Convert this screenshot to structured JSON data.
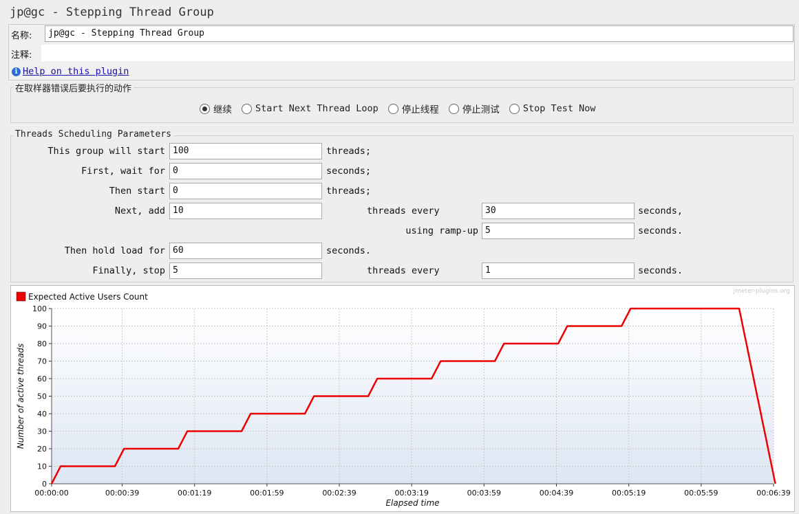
{
  "panel": {
    "title": "jp@gc - Stepping Thread Group"
  },
  "name_row": {
    "label": "名称:",
    "value": "jp@gc - Stepping Thread Group"
  },
  "comment_row": {
    "label": "注释:",
    "value": ""
  },
  "help": {
    "icon": "info-icon",
    "link": "Help on this plugin"
  },
  "on_error": {
    "legend": "在取样器错误后要执行的动作",
    "options": [
      {
        "label": "继续",
        "checked": true,
        "cjk": true
      },
      {
        "label": "Start Next Thread Loop",
        "checked": false,
        "cjk": false
      },
      {
        "label": "停止线程",
        "checked": false,
        "cjk": true
      },
      {
        "label": "停止测试",
        "checked": false,
        "cjk": true
      },
      {
        "label": "Stop Test Now",
        "checked": false,
        "cjk": false
      }
    ]
  },
  "params": {
    "legend": "Threads Scheduling Parameters",
    "rows": {
      "start": {
        "label": "This group will start",
        "value": "100",
        "unit": "threads;"
      },
      "wait": {
        "label": "First, wait for",
        "value": "0",
        "unit": "seconds;"
      },
      "then_start": {
        "label": "Then start",
        "value": "0",
        "unit": "threads;"
      },
      "next_add": {
        "label": "Next, add",
        "value": "10",
        "mid": "threads every",
        "value2": "30",
        "unit": "seconds,"
      },
      "ramp": {
        "label": "using ramp-up",
        "value": "5",
        "unit": "seconds."
      },
      "hold": {
        "label": "Then hold load for",
        "value": "60",
        "unit": "seconds."
      },
      "stop": {
        "label": "Finally, stop",
        "value": "5",
        "mid": "threads every",
        "value2": "1",
        "unit": "seconds."
      }
    }
  },
  "chart_data": {
    "type": "line",
    "watermark": "jmeter-plugins.org",
    "xlabel": "Elapsed time",
    "ylabel": "Number of active threads",
    "ylim": [
      0,
      100
    ],
    "xlim": [
      0,
      399
    ],
    "grid": true,
    "legend_position": "top-left",
    "y_ticks": [
      0,
      10,
      20,
      30,
      40,
      50,
      60,
      70,
      80,
      90,
      100
    ],
    "x_ticks": [
      {
        "t": 0,
        "label": "00:00:00"
      },
      {
        "t": 39,
        "label": "00:00:39"
      },
      {
        "t": 79,
        "label": "00:01:19"
      },
      {
        "t": 119,
        "label": "00:01:59"
      },
      {
        "t": 159,
        "label": "00:02:39"
      },
      {
        "t": 199,
        "label": "00:03:19"
      },
      {
        "t": 239,
        "label": "00:03:59"
      },
      {
        "t": 279,
        "label": "00:04:39"
      },
      {
        "t": 319,
        "label": "00:05:19"
      },
      {
        "t": 359,
        "label": "00:05:59"
      },
      {
        "t": 399,
        "label": "00:06:39"
      }
    ],
    "series": [
      {
        "name": "Expected Active Users Count",
        "color": "#ee0000",
        "points": [
          [
            0,
            0
          ],
          [
            5,
            10
          ],
          [
            35,
            10
          ],
          [
            40,
            20
          ],
          [
            70,
            20
          ],
          [
            75,
            30
          ],
          [
            105,
            30
          ],
          [
            110,
            40
          ],
          [
            140,
            40
          ],
          [
            145,
            50
          ],
          [
            175,
            50
          ],
          [
            180,
            60
          ],
          [
            210,
            60
          ],
          [
            215,
            70
          ],
          [
            245,
            70
          ],
          [
            250,
            80
          ],
          [
            280,
            80
          ],
          [
            285,
            90
          ],
          [
            315,
            90
          ],
          [
            320,
            100
          ],
          [
            380,
            100
          ],
          [
            381,
            95
          ],
          [
            382,
            90
          ],
          [
            383,
            85
          ],
          [
            384,
            80
          ],
          [
            385,
            75
          ],
          [
            386,
            70
          ],
          [
            387,
            65
          ],
          [
            388,
            60
          ],
          [
            389,
            55
          ],
          [
            390,
            50
          ],
          [
            391,
            45
          ],
          [
            392,
            40
          ],
          [
            393,
            35
          ],
          [
            394,
            30
          ],
          [
            395,
            25
          ],
          [
            396,
            20
          ],
          [
            397,
            15
          ],
          [
            398,
            10
          ],
          [
            399,
            5
          ],
          [
            400,
            0
          ]
        ]
      }
    ]
  }
}
